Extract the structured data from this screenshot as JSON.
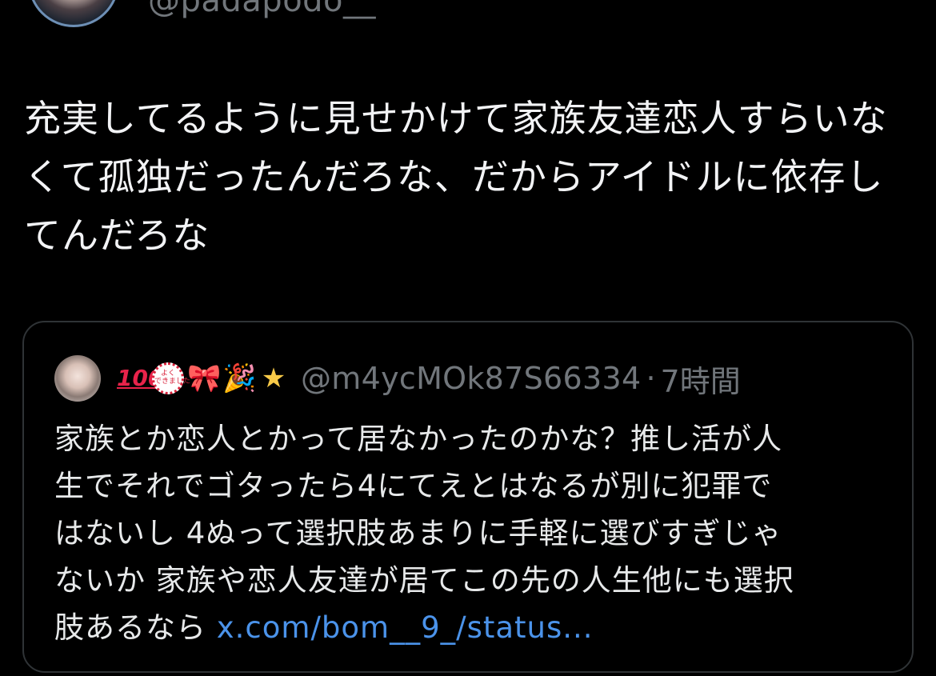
{
  "author": {
    "handle": "@padapodo__"
  },
  "tweet": {
    "text": "充実してるように見せかけて家族友達恋人すらいな\nくて孤独だったんだろな、だからアイドルに依存し\nてんだろな"
  },
  "quoted": {
    "emojis": [
      "💯",
      "stamp",
      "🎀",
      "🎉",
      "⭐"
    ],
    "handle": "@m4ycMOk87S66334",
    "separator": "·",
    "time": "7時間",
    "text": "家族とか恋人とかって居なかったのかな？推し活が人\n生でそれでゴタったら4にてえとはなるが別に犯罪で\nはないし 4ぬって選択肢あまりに手軽に選びすぎじゃ\nないか 家族や恋人友達が居てこの先の人生他にも選択\n肢あるなら ",
    "link": "x.com/bom__9_/status..."
  },
  "colors": {
    "background": "#000000",
    "text": "#e7e9ea",
    "secondary": "#71767b",
    "link": "#4b93ea",
    "border": "#2f3336"
  }
}
